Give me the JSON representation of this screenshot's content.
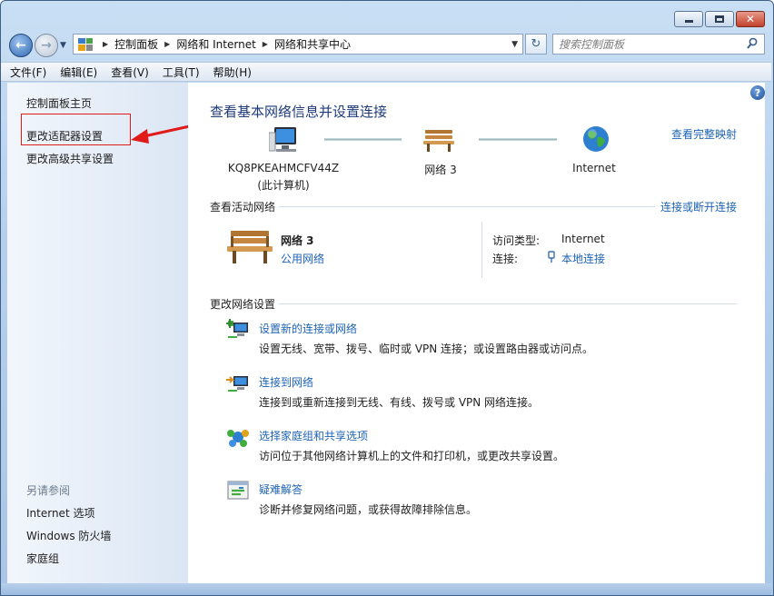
{
  "window": {
    "caption_buttons": [
      "minimize-icon",
      "maximize-icon",
      "close-icon"
    ]
  },
  "address_bar": {
    "crumbs": [
      "控制面板",
      "网络和 Internet",
      "网络和共享中心"
    ],
    "search_placeholder": "搜索控制面板"
  },
  "menu": {
    "items": [
      "文件(F)",
      "编辑(E)",
      "查看(V)",
      "工具(T)",
      "帮助(H)"
    ]
  },
  "sidebar": {
    "links": [
      "控制面板主页",
      "更改适配器设置",
      "更改高级共享设置"
    ],
    "see_also_heading": "另请参阅",
    "see_also": [
      "Internet 选项",
      "Windows 防火墙",
      "家庭组"
    ]
  },
  "main": {
    "title": "查看基本网络信息并设置连接",
    "view_full_map": "查看完整映射",
    "map": {
      "computer_name": "KQ8PKEAHMCFV44Z",
      "computer_sub": "(此计算机)",
      "network": "网络  3",
      "internet": "Internet"
    },
    "active_networks": {
      "title": "查看活动网络",
      "connect_link": "连接或断开连接",
      "name": "网络  3",
      "type": "公用网络",
      "access_type_label": "访问类型:",
      "access_type_value": "Internet",
      "connections_label": "连接:",
      "connections_value": "本地连接"
    },
    "change_settings": {
      "title": "更改网络设置",
      "tasks": [
        {
          "link": "设置新的连接或网络",
          "desc": "设置无线、宽带、拨号、临时或 VPN 连接；或设置路由器或访问点。"
        },
        {
          "link": "连接到网络",
          "desc": "连接到或重新连接到无线、有线、拨号或 VPN 网络连接。"
        },
        {
          "link": "选择家庭组和共享选项",
          "desc": "访问位于其他网络计算机上的文件和打印机，或更改共享设置。"
        },
        {
          "link": "疑难解答",
          "desc": "诊断并修复网络问题，或获得故障排除信息。"
        }
      ]
    }
  },
  "colors": {
    "link": "#1e63b6",
    "title": "#1e3b7a",
    "annotation": "#e11a1a"
  }
}
